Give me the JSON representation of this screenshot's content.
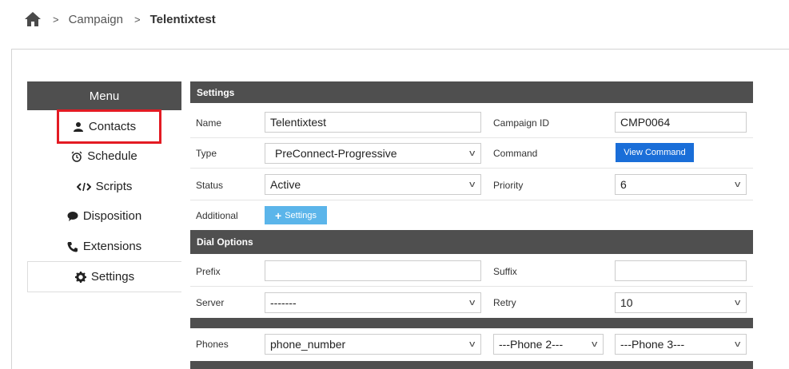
{
  "breadcrumb": {
    "home_icon": "home-icon",
    "items": [
      "Campaign",
      "Telentixtest"
    ]
  },
  "menu": {
    "title": "Menu",
    "items": [
      {
        "label": "Contacts",
        "icon": "user-icon"
      },
      {
        "label": "Schedule",
        "icon": "alarm-clock-icon"
      },
      {
        "label": "Scripts",
        "icon": "code-icon"
      },
      {
        "label": "Disposition",
        "icon": "comment-icon"
      },
      {
        "label": "Extensions",
        "icon": "phone-icon"
      },
      {
        "label": "Settings",
        "icon": "gear-icon"
      }
    ],
    "active": "Settings",
    "highlighted": "Contacts"
  },
  "settings": {
    "header": "Settings",
    "name_label": "Name",
    "name_value": "Telentixtest",
    "campaign_id_label": "Campaign ID",
    "campaign_id_value": "CMP0064",
    "type_label": "Type",
    "type_value": "PreConnect-Progressive",
    "command_label": "Command",
    "view_command_label": "View Command",
    "status_label": "Status",
    "status_value": "Active",
    "priority_label": "Priority",
    "priority_value": "6",
    "additional_label": "Additional",
    "additional_button": "Settings"
  },
  "dial_options": {
    "header": "Dial Options",
    "prefix_label": "Prefix",
    "prefix_value": "",
    "suffix_label": "Suffix",
    "suffix_value": "",
    "server_label": "Server",
    "server_value": "-------",
    "retry_label": "Retry",
    "retry_value": "10"
  },
  "phones": {
    "label": "Phones",
    "phone1": "phone_number",
    "phone2": "---Phone 2---",
    "phone3": "---Phone 3---"
  },
  "colors": {
    "header_bg": "#4f4f4f",
    "primary": "#1a6ed8",
    "light_button": "#5bb5ea",
    "highlight": "#e31b23"
  }
}
